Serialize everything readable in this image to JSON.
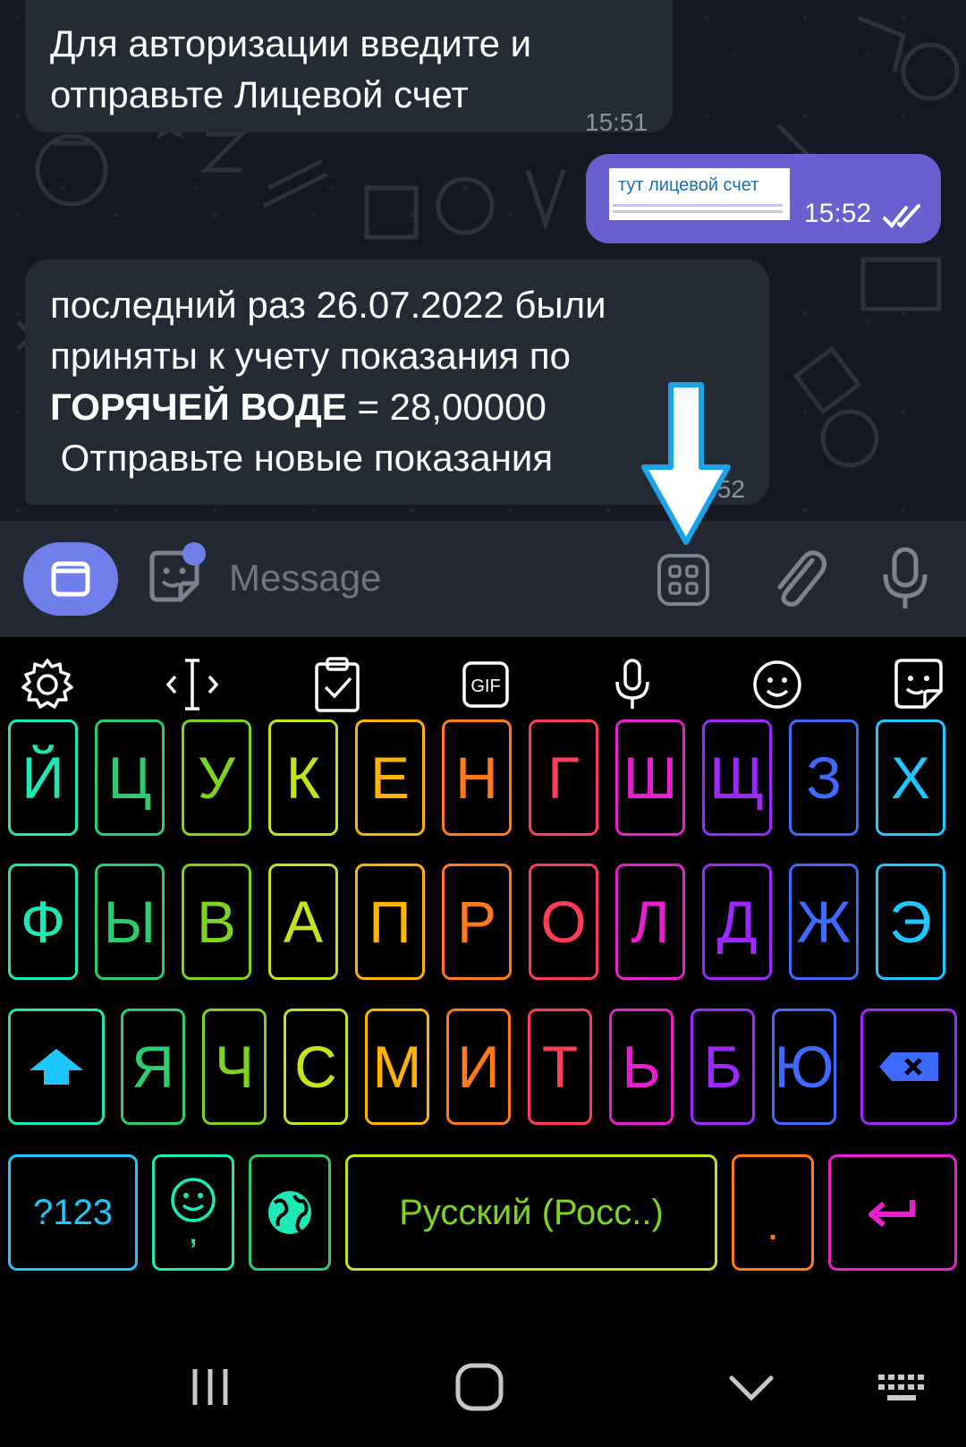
{
  "messages": {
    "first": {
      "line1": "Для авторизации введите и",
      "line2": "отправьте Лицевой счет",
      "time": "15:51"
    },
    "outgoing": {
      "label": "тут лицевой счет",
      "time": "15:52"
    },
    "second": {
      "line1": "последний раз 26.07.2022 были",
      "line2": "приняты к учету показания по",
      "line3_bold": "ГОРЯЧЕЙ ВОДЕ",
      "line3_rest": " = 28,00000",
      "line4": " Отправьте новые показания",
      "time": ":52"
    }
  },
  "input": {
    "placeholder": "Message"
  },
  "keyboard": {
    "row1": [
      "Й",
      "Ц",
      "У",
      "К",
      "Е",
      "Н",
      "Г",
      "Ш",
      "Щ",
      "З",
      "Х"
    ],
    "row2": [
      "Ф",
      "Ы",
      "В",
      "А",
      "П",
      "Р",
      "О",
      "Л",
      "Д",
      "Ж",
      "Э"
    ],
    "row3": [
      "Я",
      "Ч",
      "С",
      "М",
      "И",
      "Т",
      "Ь",
      "Б",
      "Ю"
    ],
    "symbols_label": "?123",
    "comma_label": ",",
    "space_label": "Русский (Росс..)",
    "period_label": "."
  },
  "colors": {
    "accent": "#6a5fd1",
    "chat_bg": "#141820",
    "bubble_in": "#252b35",
    "arrow": "#1aa3e8",
    "rainbow": [
      "#1de9b6",
      "#2ecc71",
      "#7ed321",
      "#c6e21a",
      "#ffb300",
      "#ff7a1a",
      "#ff3d5a",
      "#e91ecf",
      "#9c27ff",
      "#3d6bff",
      "#1ec8ff"
    ]
  },
  "icons": [
    "bot-menu-icon",
    "sticker-icon",
    "apps-grid-icon",
    "attach-icon",
    "mic-icon",
    "settings-icon",
    "cursor-icon",
    "clipboard-icon",
    "gif-icon",
    "voice-icon",
    "emoji-icon",
    "sticker-icon",
    "shift-icon",
    "backspace-icon",
    "emoji-comma-icon",
    "globe-icon",
    "enter-icon",
    "recents-icon",
    "home-icon",
    "back-icon",
    "keyboard-icon"
  ]
}
